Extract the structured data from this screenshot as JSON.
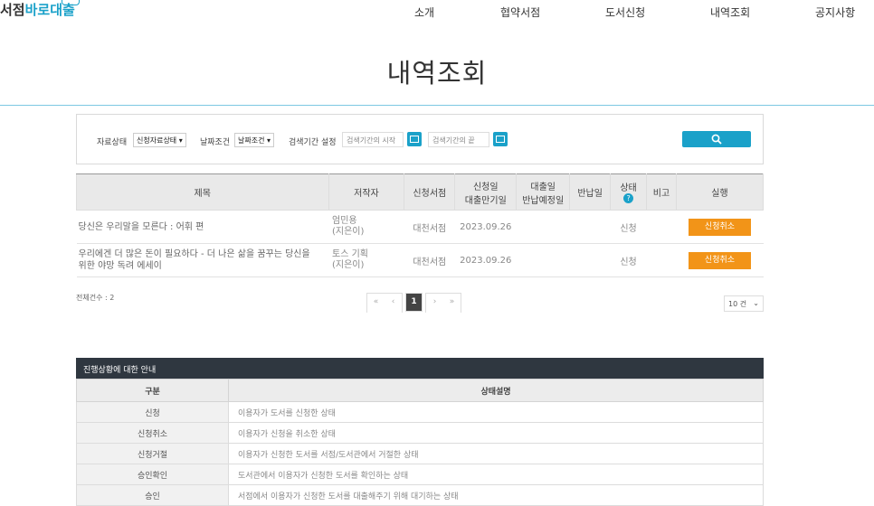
{
  "header": {
    "logo_part1": "서점",
    "logo_part2": "바로대출",
    "nav": [
      "소개",
      "협약서점",
      "도서신청",
      "내역조회",
      "공지사항"
    ]
  },
  "page_title": "내역조회",
  "search": {
    "label_status": "자료상태",
    "select_status": "신청자료상태",
    "label_date_cond": "날짜조건",
    "select_date_cond": "날짜조건",
    "label_period": "검색기간 설정",
    "start_placeholder": "검색기간의 시작",
    "end_placeholder": "검색기간의 끝"
  },
  "table": {
    "headers": {
      "title": "제목",
      "author": "저작자",
      "store": "신청서점",
      "date1": "신청일",
      "date2": "대출만기일",
      "loan1": "대출일",
      "loan2": "반납예정일",
      "return": "반납일",
      "status": "상태",
      "note": "비고",
      "action": "실행"
    },
    "rows": [
      {
        "title1": "당신은 우리말을 모른다 : 어휘 편",
        "title2": "",
        "author1": "엄민용",
        "author2": "(지은이)",
        "store": "대천서점",
        "date": "2023.09.26",
        "status": "신청",
        "action": "신청취소"
      },
      {
        "title1": "우리에겐 더 많은 돈이 필요하다 - 더 나은 삶을 꿈꾸는 당신을",
        "title2": "위한 야망 독려 에세이",
        "author1": "토스 기획",
        "author2": "(지은이)",
        "store": "대천서점",
        "date": "2023.09.26",
        "status": "신청",
        "action": "신청취소"
      }
    ]
  },
  "total": "전체건수 : 2",
  "pagination": {
    "first": "«",
    "prev": "‹",
    "current": "1",
    "next": "›",
    "last": "»"
  },
  "per_page": "10 건",
  "guide": {
    "title": "진행상황에 대한 안내",
    "col1": "구분",
    "col2": "상태설명",
    "rows": [
      {
        "k": "신청",
        "v": "이용자가 도서를 신청한 상태"
      },
      {
        "k": "신청취소",
        "v": "이용자가 신청을 취소한 상태"
      },
      {
        "k": "신청거절",
        "v": "이용자가 신청한 도서를 서점/도서관에서 거절한 상태"
      },
      {
        "k": "승인확인",
        "v": "도서관에서 이용자가 신청한 도서를 확인하는 상태"
      },
      {
        "k": "승인",
        "v": "서점에서 이용자가 신청한 도서를 대출해주기 위해 대기하는 상태"
      }
    ]
  },
  "colors": {
    "accent": "#1aa1c9",
    "cancel": "#f29418",
    "guide_header": "#2f3740"
  },
  "icons": {
    "search": "search-icon",
    "calendar": "calendar-icon",
    "status_help": "help-icon"
  }
}
